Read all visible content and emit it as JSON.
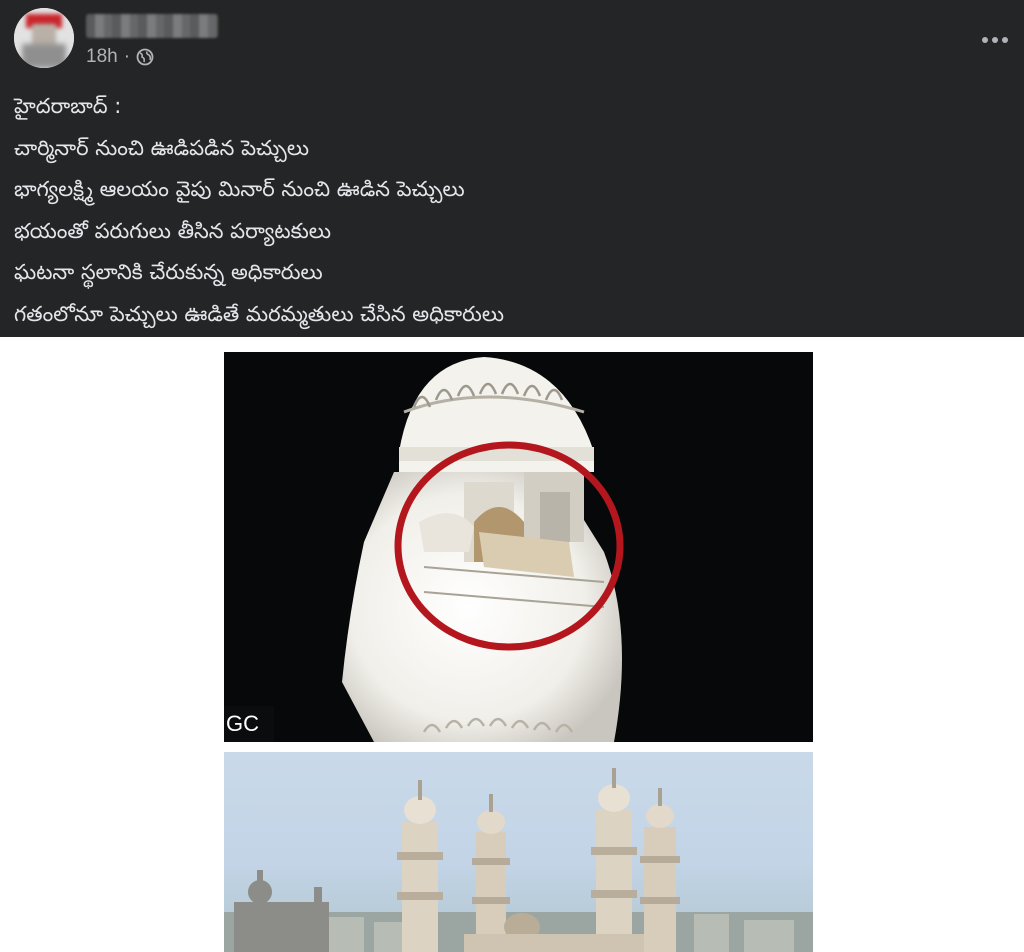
{
  "post": {
    "author": "",
    "time": "18h",
    "separator": "·",
    "privacy_icon": "globe-icon",
    "more_icon": "more-options-icon",
    "lines": [
      "హైదరాబాద్ :",
      "చార్మినార్ నుంచి ఊడిపడిన పెచ్చులు",
      "భాగ్యలక్ష్మి ఆలయం వైపు మినార్ నుంచి ఊడిన పెచ్చులు",
      "భయంతో పరుగులు తీసిన పర్యాటకులు",
      "ఘటనా స్థలానికి చేరుకున్న అధికారులు",
      "గతంలోనూ పెచ్చులు ఊడితే మరమ్మతులు చేసిన అధికారులు"
    ]
  },
  "media": {
    "photo1_watermark": "GC"
  },
  "colors": {
    "header_bg": "#242526",
    "text": "#e4e6eb",
    "secondary_text": "#b0b3b8",
    "highlight_circle": "#b3171d"
  }
}
